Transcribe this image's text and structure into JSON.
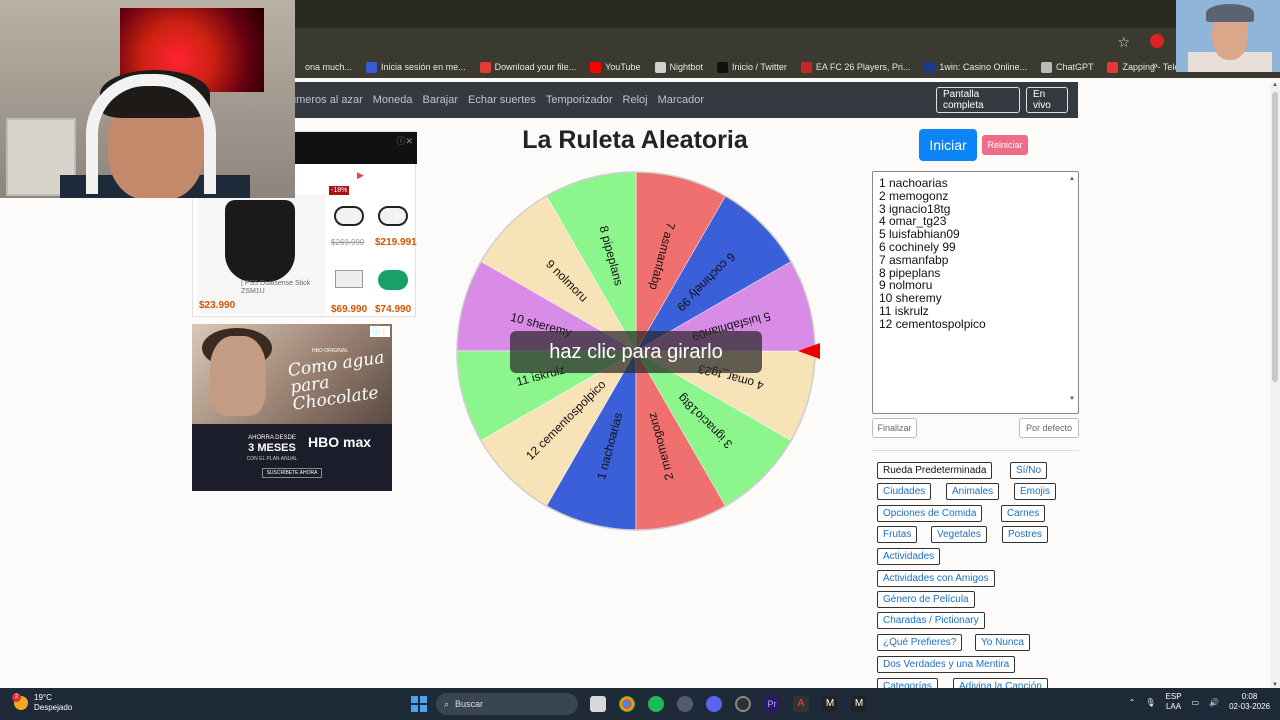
{
  "browser": {
    "bookmarks": [
      {
        "label": "ona much...",
        "color": "#3a3a30"
      },
      {
        "label": "Inicia sesión en me...",
        "color": "#3b5bd6"
      },
      {
        "label": "Download your file...",
        "color": "#e53935"
      },
      {
        "label": "YouTube",
        "color": "#ff0000"
      },
      {
        "label": "Nightbot",
        "color": "#d0d0d0"
      },
      {
        "label": "Inicio / Twitter",
        "color": "#111111"
      },
      {
        "label": "EA FC 26 Players, Pri...",
        "color": "#c62828"
      },
      {
        "label": "1win: Casino Online...",
        "color": "#1e3a8a"
      },
      {
        "label": "ChatGPT",
        "color": "#bbbbbb"
      },
      {
        "label": "Zapping - Televisión...",
        "color": "#e53935"
      }
    ],
    "bookmarks_more": "»"
  },
  "nav": {
    "links": [
      "úmeros al azar",
      "Moneda",
      "Barajar",
      "Echar suertes",
      "Temporizador",
      "Reloj",
      "Marcador"
    ],
    "fullscreen": "Pantalla completa",
    "live": "En vivo"
  },
  "ad1": {
    "product_name": "| PS5 Dualsense Stick ZSM1U",
    "main_price": "$23.990",
    "discount": "-18%",
    "old_price": "$269.990",
    "price2": "$219.991",
    "price3": "$69.990",
    "price4": "$74.990"
  },
  "ad2": {
    "brand": "HBO ORIGINAL",
    "movie": "Como agua para Chocolate",
    "offer": "AHORRA DESDE",
    "months": "3 MESES",
    "plan": "CON EL PLAN ANUAL",
    "logo": "HBO max",
    "cta": "SUSCRÍBETE AHORA"
  },
  "main": {
    "title": "La Ruleta Aleatoria",
    "wheel_prompt": "haz clic para girarlo",
    "start": "Iniciar",
    "reset": "Reiniciar",
    "finish": "Finalizar",
    "default": "Por defecto"
  },
  "wheel": {
    "segments": [
      {
        "label": "1 nachoarias",
        "color": "#3a5fd8"
      },
      {
        "label": "2 memogonz",
        "color": "#f07070"
      },
      {
        "label": "3 ignacio18tg",
        "color": "#8cf58c"
      },
      {
        "label": "4 omar_tg23",
        "color": "#f8e2b8"
      },
      {
        "label": "5 luisfabhian09",
        "color": "#d98ce6"
      },
      {
        "label": "6 cochinely 99",
        "color": "#3a5fd8"
      },
      {
        "label": "7 asmanfabp",
        "color": "#f07070"
      },
      {
        "label": "8 pipeplans",
        "color": "#8cf58c"
      },
      {
        "label": "9 nolmoru",
        "color": "#f8e2b8"
      },
      {
        "label": "10 sheremy",
        "color": "#d98ce6"
      },
      {
        "label": "11 iskrulz",
        "color": "#8cf58c"
      },
      {
        "label": "12 cementospolpico",
        "color": "#f8e2b8"
      }
    ]
  },
  "entries": [
    "1 nachoarias",
    "2 memogonz",
    "3 ignacio18tg",
    "4 omar_tg23",
    "5 luisfabhian09",
    "6 cochinely 99",
    "7 asmanfabp",
    "8 pipeplans",
    "9 nolmoru",
    "10 sheremy",
    "11 iskrulz",
    "12 cementospolpico"
  ],
  "presets": [
    "Rueda Predeterminada",
    "Sí/No",
    "Ciudades",
    "Animales",
    "Emojis",
    "Opciones de Comida",
    "Carnes",
    "Frutas",
    "Vegetales",
    "Postres",
    "Actividades",
    "Actividades con Amigos",
    "Género de Película",
    "Charadas / Pictionary",
    "¿Qué Prefieres?",
    "Yo Nunca",
    "Dos Verdades y una Mentira",
    "Categorías",
    "Adivina la Canción"
  ],
  "taskbar": {
    "weather_badge": "2",
    "temp": "19°C",
    "condition": "Despejado",
    "search": "Buscar",
    "lang1": "ESP",
    "lang2": "LAA",
    "time": "0:08",
    "date": "02-03-2026"
  }
}
